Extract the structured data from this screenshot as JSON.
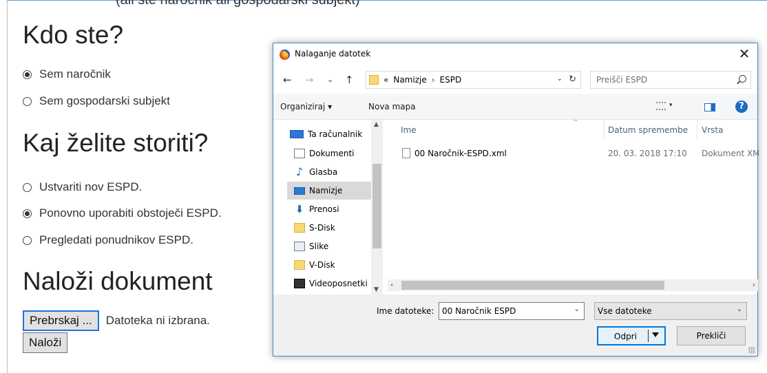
{
  "page": {
    "top_cut_text": "(ali ste naročnik ali gospodarski subjekt)",
    "who_heading": "Kdo ste?",
    "who_options": [
      {
        "label": "Sem naročnik",
        "checked": true
      },
      {
        "label": "Sem gospodarski subjekt",
        "checked": false
      }
    ],
    "what_heading": "Kaj želite storiti?",
    "what_options": [
      {
        "label": "Ustvariti nov ESPD.",
        "checked": false
      },
      {
        "label": "Ponovno uporabiti obstoječi ESPD.",
        "checked": true
      },
      {
        "label": "Pregledati ponudnikov ESPD.",
        "checked": false
      }
    ],
    "upload_heading": "Naloži dokument",
    "browse_label": "Prebrskaj ...",
    "browse_status": "Datoteka ni izbrana.",
    "upload_label": "Naloži"
  },
  "dialog": {
    "title": "Nalaganje datotek",
    "close_glyph": "✕",
    "nav": {
      "back": "←",
      "forward": "→",
      "recent": "⌄",
      "up": "↑"
    },
    "address": {
      "overflow": "«",
      "crumbs": [
        "Namizje",
        "ESPD"
      ],
      "separator": "›",
      "dropdown": "⌄",
      "refresh": "↻"
    },
    "search_placeholder": "Preišči ESPD",
    "toolbar": {
      "organize": "Organiziraj ▾",
      "new_folder": "Nova mapa",
      "view_dropdown": "▾",
      "help": "?"
    },
    "nav_items": [
      {
        "label": "Ta računalnik",
        "icon": "pc-icon"
      },
      {
        "label": "Dokumenti",
        "icon": "documents-icon"
      },
      {
        "label": "Glasba",
        "icon": "music-icon"
      },
      {
        "label": "Namizje",
        "icon": "desktop-icon",
        "selected": true
      },
      {
        "label": "Prenosi",
        "icon": "downloads-icon"
      },
      {
        "label": "S-Disk",
        "icon": "folder-icon"
      },
      {
        "label": "Slike",
        "icon": "pictures-icon"
      },
      {
        "label": "V-Disk",
        "icon": "folder-icon"
      },
      {
        "label": "Videoposnetki",
        "icon": "videos-icon"
      }
    ],
    "columns": {
      "name": "Ime",
      "date": "Datum spremembe",
      "type": "Vrsta"
    },
    "files": [
      {
        "name": "00 Naročnik-ESPD.xml",
        "date": "20. 03. 2018 17:10",
        "type": "Dokument XML"
      }
    ],
    "filename_label": "Ime datoteke:",
    "filename_value": "00 Naročnik ESPD",
    "filter_value": "Vse datoteke",
    "open_label": "Odpri",
    "cancel_label": "Prekliči"
  }
}
